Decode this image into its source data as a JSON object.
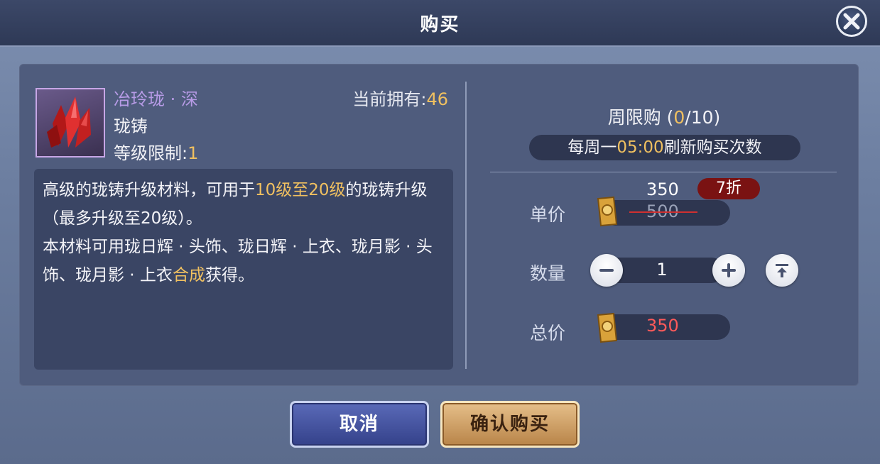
{
  "dialog": {
    "title": "购买"
  },
  "item": {
    "name": "冶玲珑 · 深",
    "type": "珑铸",
    "level_label": "等级限制:",
    "level_value": "1",
    "owned_label": "当前拥有:",
    "owned_value": "46",
    "icon": "red-crystal-icon",
    "desc": {
      "p1_a": "高级的珑铸升级材料，可用于",
      "p1_hl": "10级至20级",
      "p1_b": "的珑铸升级（最多升级至20级）。",
      "p2_a": "本材料可用珑日辉 · 头饰、珑日辉 · 上衣、珑月影 · 头饰、珑月影 · 上衣",
      "p2_hl": "合成",
      "p2_b": "获得。"
    }
  },
  "purchase": {
    "weekly_label": "周限购 (",
    "weekly_bought": "0",
    "weekly_total": "/10)",
    "refresh_a": "每周一",
    "refresh_time": "05:00",
    "refresh_b": "刷新购买次数",
    "unit_price_label": "单价",
    "unit_price": "350",
    "original_price": "500",
    "discount": "7折",
    "quantity_label": "数量",
    "quantity": "1",
    "total_label": "总价",
    "total": "350",
    "currency_icon": "gold-ticket-icon"
  },
  "buttons": {
    "cancel": "取消",
    "confirm": "确认购买"
  },
  "colors": {
    "highlight": "#f0c060",
    "item_name": "#b79be6",
    "total_price": "#ff5a5a",
    "discount_bg": "#7a1212"
  }
}
